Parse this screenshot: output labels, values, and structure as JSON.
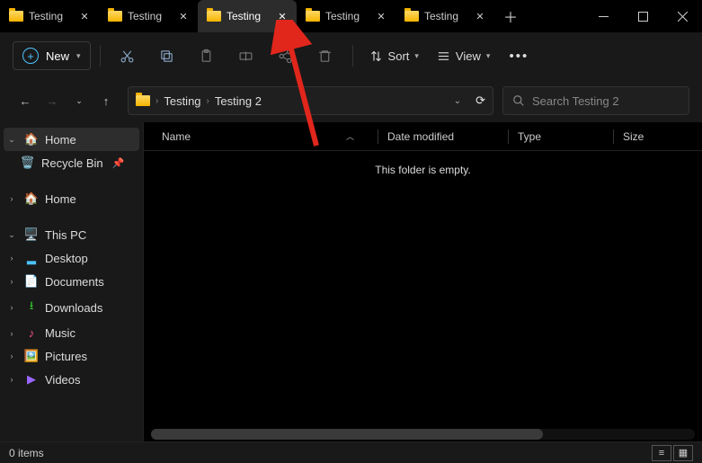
{
  "tabs": [
    {
      "label": "Testing"
    },
    {
      "label": "Testing"
    },
    {
      "label": "Testing",
      "active": true
    },
    {
      "label": "Testing"
    },
    {
      "label": "Testing"
    }
  ],
  "toolbar": {
    "new_label": "New",
    "sort_label": "Sort",
    "view_label": "View"
  },
  "breadcrumb": {
    "seg1": "Testing",
    "seg2": "Testing 2"
  },
  "search": {
    "placeholder": "Search Testing 2"
  },
  "sidebar": {
    "home": "Home",
    "recycle": "Recycle Bin",
    "home2": "Home",
    "thispc": "This PC",
    "desktop": "Desktop",
    "documents": "Documents",
    "downloads": "Downloads",
    "music": "Music",
    "pictures": "Pictures",
    "videos": "Videos"
  },
  "columns": {
    "name": "Name",
    "date": "Date modified",
    "type": "Type",
    "size": "Size"
  },
  "empty_text": "This folder is empty.",
  "status": {
    "items": "0 items"
  }
}
